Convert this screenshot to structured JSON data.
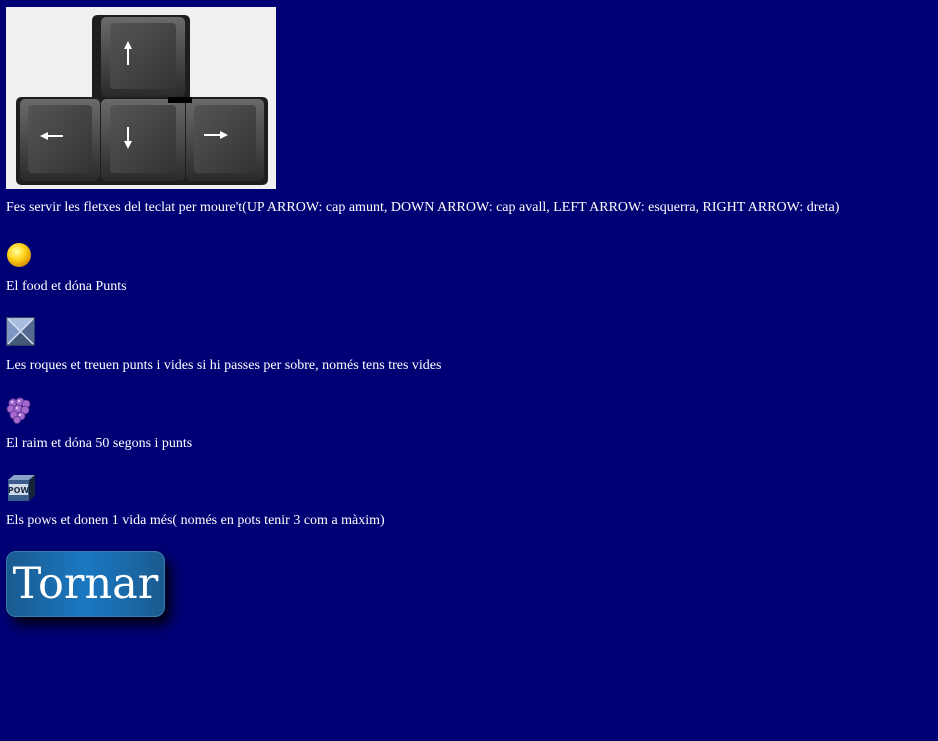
{
  "instructions": {
    "arrows_text": "Fes servir les fletxes del teclat per moure't(UP ARROW: cap amunt, DOWN ARROW: cap avall, LEFT ARROW: esquerra, RIGHT ARROW: dreta)",
    "food_text": "El food et dóna Punts",
    "rocks_text": "Les roques et treuen punts i vides si hi passes per sobre, només tens tres vides",
    "grapes_text": "El raim et dóna 50 segons i punts",
    "pow_text": "Els pows et donen 1 vida més( només en pots tenir 3 com a màxim)",
    "pow_icon_label": "POW"
  },
  "icons": {
    "keyboard": "arrow-keys-image",
    "food": "yellow-ball-icon",
    "rock": "rock-block-icon",
    "grapes": "grapes-icon",
    "pow": "pow-block-icon"
  },
  "back_button": {
    "label": "Tornar"
  },
  "colors": {
    "background": "#000075",
    "text": "#ffffff",
    "button": "#1a6fb3"
  }
}
